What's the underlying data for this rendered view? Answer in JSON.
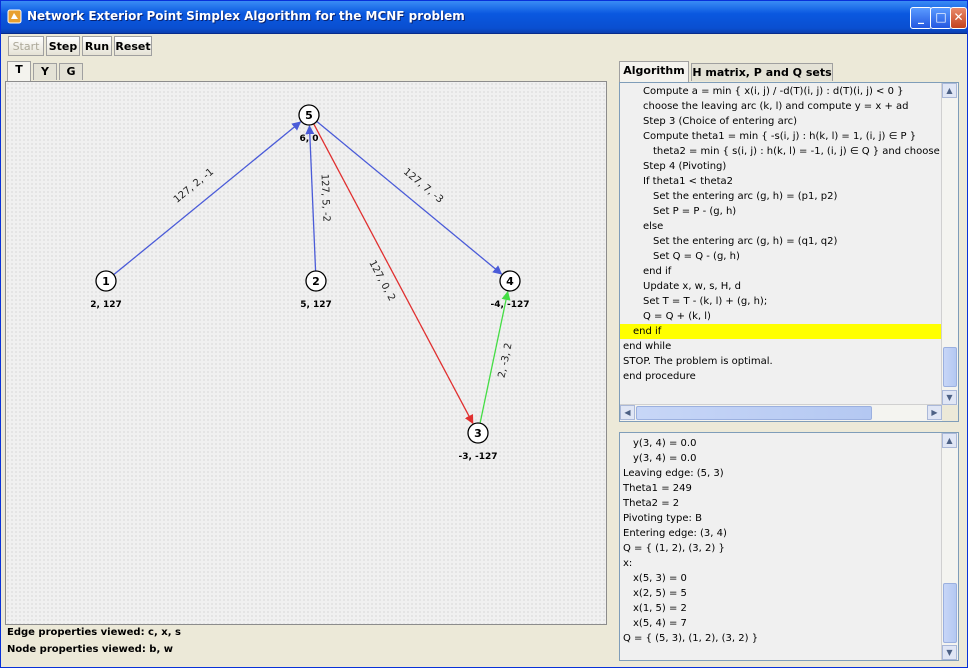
{
  "window": {
    "title": "Network Exterior Point Simplex Algorithm for the MCNF problem",
    "controls": [
      "_",
      "□",
      "✕"
    ]
  },
  "toolbar": {
    "start": "Start",
    "step": "Step",
    "run": "Run",
    "reset": "Reset"
  },
  "view_tabs": [
    "T",
    "Y",
    "G"
  ],
  "graph": {
    "nodes": [
      {
        "id": "5",
        "label": "6, 0"
      },
      {
        "id": "1",
        "label": "2, 127"
      },
      {
        "id": "2",
        "label": "5, 127"
      },
      {
        "id": "4",
        "label": "-4, -127"
      },
      {
        "id": "3",
        "label": "-3, -127"
      }
    ],
    "edges": [
      {
        "from": "1",
        "to": "5",
        "label": "127, 2, -1",
        "color": "#4a5bd8"
      },
      {
        "from": "2",
        "to": "5",
        "label": "127, 5, -2",
        "color": "#4a5bd8"
      },
      {
        "from": "5",
        "to": "4",
        "label": "127, 7, -3",
        "color": "#4a5bd8"
      },
      {
        "from": "5",
        "to": "3",
        "label": "127, 0, 2",
        "color": "#e03030"
      },
      {
        "from": "3",
        "to": "4",
        "label": "2, -3, 2",
        "color": "#44dd44"
      }
    ]
  },
  "status": {
    "edge_props": "Edge properties viewed: c, x, s",
    "node_props": "Node properties viewed: b, w"
  },
  "right_tabs": [
    "Algorithm",
    "H matrix, P and Q sets"
  ],
  "algorithm": {
    "lines": [
      {
        "text": "Compute a = min { x(i, j) / -d(T)(i, j) : d(T)(i, j) < 0 }",
        "indent": 2,
        "hl": false
      },
      {
        "text": "choose the leaving arc (k, l) and compute y = x + ad",
        "indent": 2,
        "hl": false
      },
      {
        "text": "Step 3 (Choice of entering arc)",
        "indent": 2,
        "hl": false
      },
      {
        "text": "Compute theta1 = min { -s(i, j) : h(k, l) = 1, (i, j) ∈ P }",
        "indent": 2,
        "hl": false
      },
      {
        "text": "theta2 = min { s(i, j) : h(k, l) = -1, (i, j) ∈ Q } and choose the",
        "indent": 3,
        "hl": false
      },
      {
        "text": "Step 4 (Pivoting)",
        "indent": 2,
        "hl": false
      },
      {
        "text": "If theta1 < theta2",
        "indent": 2,
        "hl": false
      },
      {
        "text": "Set the entering arc (g, h) = (p1, p2)",
        "indent": 3,
        "hl": false
      },
      {
        "text": "Set P = P - (g, h)",
        "indent": 3,
        "hl": false
      },
      {
        "text": "else",
        "indent": 2,
        "hl": false
      },
      {
        "text": "Set the entering arc (g, h) = (q1, q2)",
        "indent": 3,
        "hl": false
      },
      {
        "text": "Set Q = Q - (g, h)",
        "indent": 3,
        "hl": false
      },
      {
        "text": "end if",
        "indent": 2,
        "hl": false
      },
      {
        "text": "Update x, w, s, H, d",
        "indent": 2,
        "hl": false
      },
      {
        "text": "Set T = T - (k, l) + (g, h);",
        "indent": 2,
        "hl": false
      },
      {
        "text": "Q = Q + (k, l)",
        "indent": 2,
        "hl": false
      },
      {
        "text": "end if",
        "indent": 1,
        "hl": true
      },
      {
        "text": "end while",
        "indent": 0,
        "hl": false
      },
      {
        "text": "STOP. The problem is optimal.",
        "indent": 0,
        "hl": false
      },
      {
        "text": "end procedure",
        "indent": 0,
        "hl": false
      }
    ]
  },
  "output": {
    "lines": [
      {
        "text": "y(3, 4) = 0.0",
        "indent": 1
      },
      {
        "text": "y(3, 4) = 0.0",
        "indent": 1
      },
      {
        "text": "Leaving edge: (5, 3)",
        "indent": 0
      },
      {
        "text": "Theta1 = 249",
        "indent": 0
      },
      {
        "text": "Theta2 = 2",
        "indent": 0
      },
      {
        "text": "Pivoting type: B",
        "indent": 0
      },
      {
        "text": "Entering edge: (3, 4)",
        "indent": 0
      },
      {
        "text": "Q = { (1, 2), (3, 2) }",
        "indent": 0
      },
      {
        "text": "x:",
        "indent": 0
      },
      {
        "text": "x(5, 3) = 0",
        "indent": 1
      },
      {
        "text": "x(2, 5) = 5",
        "indent": 1
      },
      {
        "text": "x(1, 5) = 2",
        "indent": 1
      },
      {
        "text": "x(5, 4) = 7",
        "indent": 1
      },
      {
        "text": "Q = { (5, 3), (1, 2), (3, 2) }",
        "indent": 0
      }
    ]
  }
}
